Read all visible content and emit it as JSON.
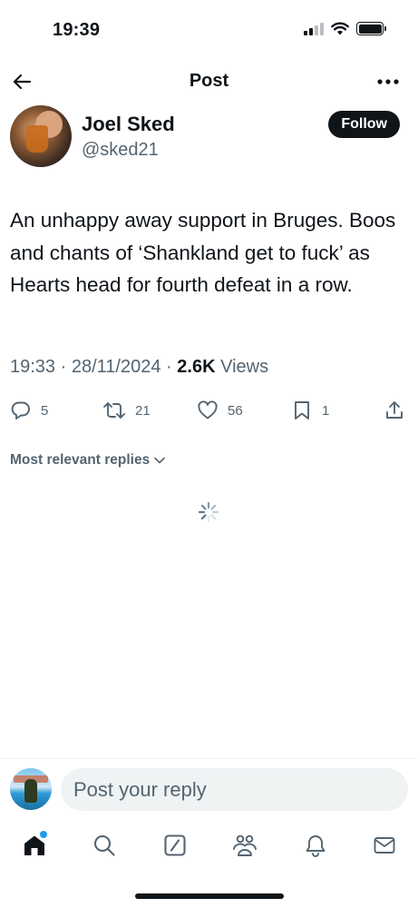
{
  "status_bar": {
    "time": "19:39"
  },
  "header": {
    "title": "Post"
  },
  "author": {
    "name": "Joel Sked",
    "handle": "@sked21",
    "follow_label": "Follow"
  },
  "tweet": {
    "text": "An unhappy away support in Bruges. Boos and chants of ‘Shankland get to fuck’ as Hearts head for fourth defeat in a row.",
    "time": "19:33",
    "date": "28/11/2024",
    "views_count": "2.6K",
    "views_label": "Views",
    "separator": "·"
  },
  "actions": {
    "replies": "5",
    "reposts": "21",
    "likes": "56",
    "bookmarks": "1"
  },
  "replies_sort": {
    "label": "Most relevant replies"
  },
  "reply_bar": {
    "placeholder": "Post your reply"
  },
  "tab_bar": {
    "items": [
      {
        "icon": "home-icon",
        "active": true
      },
      {
        "icon": "search-icon"
      },
      {
        "icon": "grok-icon"
      },
      {
        "icon": "communities-icon"
      },
      {
        "icon": "notifications-icon"
      },
      {
        "icon": "messages-icon"
      }
    ]
  },
  "colors": {
    "text": "#0f1419",
    "secondary": "#536471",
    "accent": "#1d9bf0",
    "input_bg": "#eff3f4"
  }
}
